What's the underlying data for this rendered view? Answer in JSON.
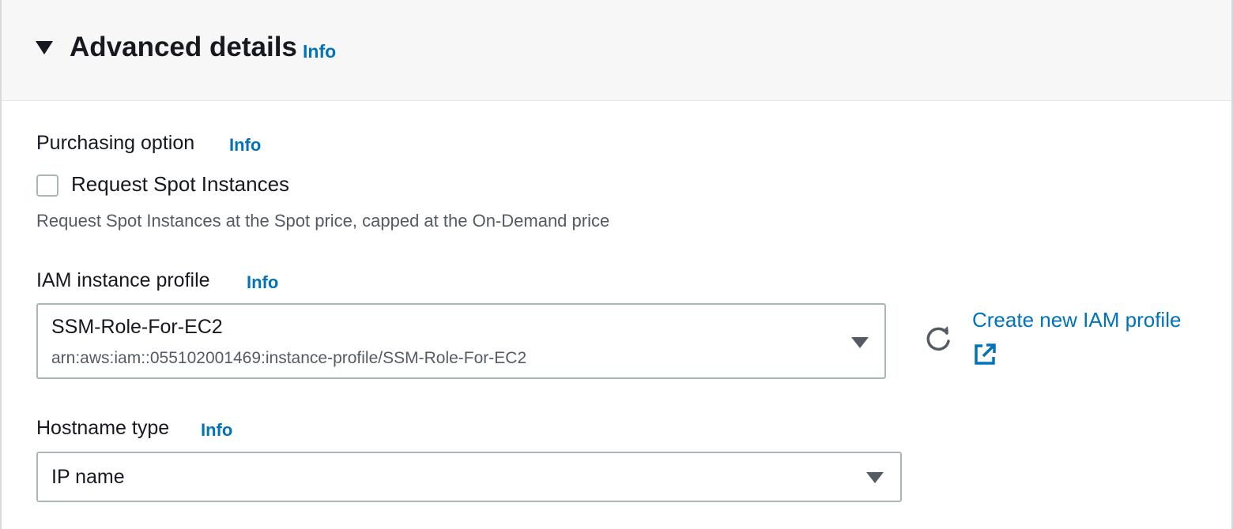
{
  "header": {
    "title": "Advanced details",
    "info": "Info"
  },
  "purchasing": {
    "label": "Purchasing option",
    "info": "Info",
    "checkbox_label": "Request Spot Instances",
    "checked": false,
    "description": "Request Spot Instances at the Spot price, capped at the On-Demand price"
  },
  "iam": {
    "label": "IAM instance profile",
    "info": "Info",
    "selected_value": "SSM-Role-For-EC2",
    "selected_sub": "arn:aws:iam::055102001469:instance-profile/SSM-Role-For-EC2",
    "create_link": "Create new IAM profile"
  },
  "hostname": {
    "label": "Hostname type",
    "info": "Info",
    "selected_value": "IP name"
  },
  "colors": {
    "link": "#0073bb",
    "text": "#16191f",
    "muted": "#545b64",
    "header_bg": "#f7f7f7",
    "border": "#aab7b8"
  },
  "icons": [
    "caret-down-icon",
    "refresh-icon",
    "external-link-icon",
    "chevron-down-icon"
  ]
}
